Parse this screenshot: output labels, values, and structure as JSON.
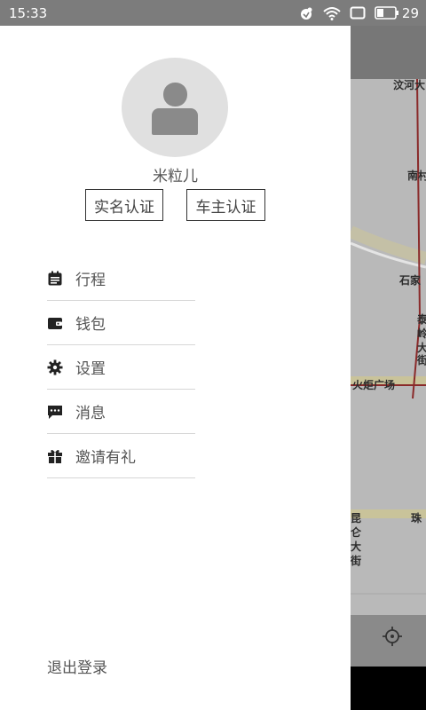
{
  "status_bar": {
    "time": "15:33",
    "battery": "29"
  },
  "map": {
    "labels": [
      "汶河大",
      "南村",
      "石家",
      "泰",
      "岭",
      "大",
      "街",
      "火炬广场",
      "昆",
      "仑",
      "大",
      "街",
      "珠"
    ]
  },
  "drawer": {
    "username": "米粒儿",
    "auth_buttons": {
      "real_name": "实名认证",
      "car_owner": "车主认证"
    },
    "menu": [
      {
        "label": "行程",
        "icon": "calendar-icon"
      },
      {
        "label": "钱包",
        "icon": "wallet-icon"
      },
      {
        "label": "设置",
        "icon": "gear-icon"
      },
      {
        "label": "消息",
        "icon": "message-icon"
      },
      {
        "label": "邀请有礼",
        "icon": "gift-icon"
      }
    ],
    "logout": "退出登录"
  }
}
